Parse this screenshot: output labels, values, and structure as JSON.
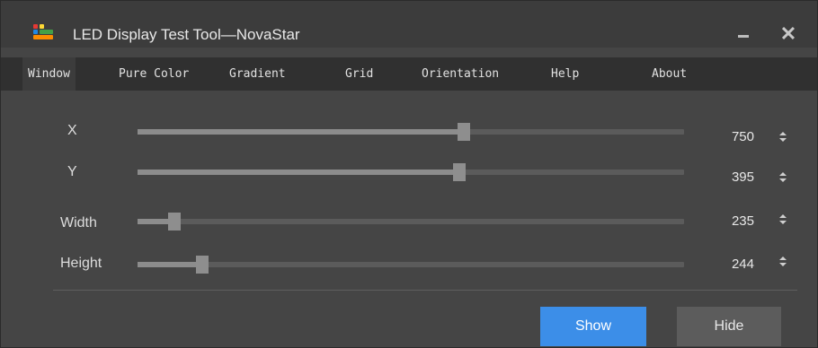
{
  "window": {
    "title": "LED Display Test Tool—NovaStar"
  },
  "colors": {
    "accent": "#3c8ee8",
    "background": "#454545",
    "menubar": "#303030"
  },
  "icons": {
    "app": "led-app-icon",
    "minimize": "minimize-icon",
    "close": "close-icon",
    "spinner": "spinner-arrows-icon"
  },
  "titlebar": {
    "close_glyph": "✕"
  },
  "menu": [
    "Window",
    "Pure Color",
    "Gradient",
    "Grid",
    "Orientation",
    "Help",
    "About"
  ],
  "controls": [
    {
      "label": "X",
      "value": "750",
      "fraction": 0.597
    },
    {
      "label": "Y",
      "value": "395",
      "fraction": 0.588
    },
    {
      "label": "Width",
      "value": "235",
      "fraction": 0.067
    },
    {
      "label": "Height",
      "value": "244",
      "fraction": 0.118
    }
  ],
  "buttons": {
    "show": "Show",
    "hide": "Hide"
  }
}
